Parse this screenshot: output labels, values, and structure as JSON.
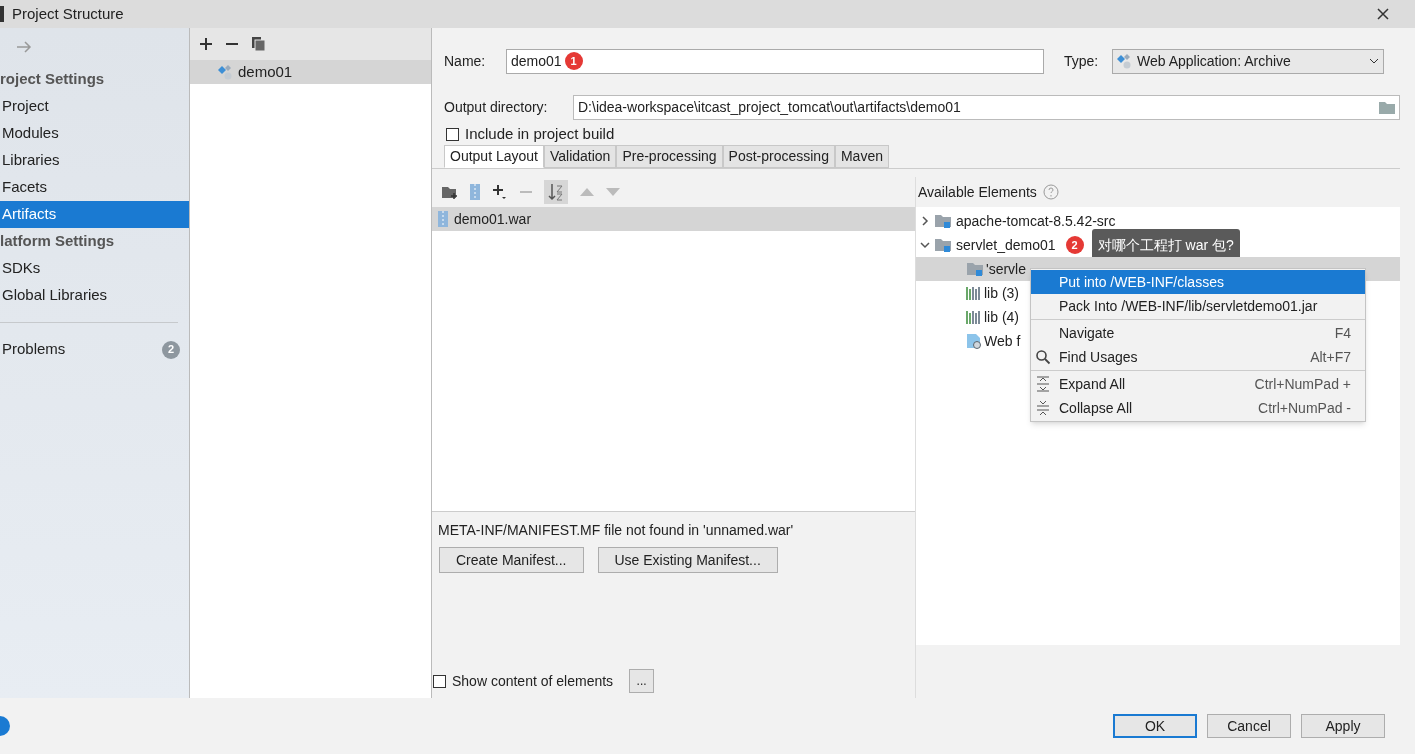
{
  "window": {
    "title": "Project Structure"
  },
  "sidebar": {
    "sections": [
      {
        "header": "roject Settings",
        "items": [
          {
            "label": "Project",
            "selected": false
          },
          {
            "label": "Modules",
            "selected": false
          },
          {
            "label": "Libraries",
            "selected": false
          },
          {
            "label": "Facets",
            "selected": false
          },
          {
            "label": "Artifacts",
            "selected": true
          }
        ]
      },
      {
        "header": "latform Settings",
        "items": [
          {
            "label": "SDKs",
            "selected": false
          },
          {
            "label": "Global Libraries",
            "selected": false
          }
        ]
      }
    ],
    "problems": {
      "label": "Problems",
      "count": "2"
    }
  },
  "artifacts": [
    {
      "label": "demo01",
      "selected": true
    }
  ],
  "form": {
    "name_label": "Name:",
    "name": "demo01",
    "name_marker": "1",
    "type_label": "Type:",
    "type": "Web Application: Archive",
    "output_label": "Output directory:",
    "output": "D:\\idea-workspace\\itcast_project_tomcat\\out\\artifacts\\demo01",
    "include": {
      "label": "Include in project build",
      "checked": false
    }
  },
  "tabs": [
    {
      "label": "Output Layout",
      "selected": true
    },
    {
      "label": "Validation",
      "selected": false
    },
    {
      "label": "Pre-processing",
      "selected": false
    },
    {
      "label": "Post-processing",
      "selected": false
    },
    {
      "label": "Maven",
      "selected": false
    }
  ],
  "output_layout": {
    "items": [
      {
        "label": "demo01.war",
        "selected": true
      }
    ],
    "message": "META-INF/MANIFEST.MF file not found in 'unnamed.war'",
    "buttons": [
      "Create Manifest...",
      "Use Existing Manifest..."
    ]
  },
  "available": {
    "title": "Available Elements",
    "tree": [
      {
        "label": "apache-tomcat-8.5.42-src",
        "expanded": false
      },
      {
        "label": "servlet_demo01",
        "expanded": true,
        "marker": "2",
        "tooltip": "对哪个工程打 war 包?",
        "children": [
          {
            "label": "'servle",
            "kind": "folder",
            "selected": true
          },
          {
            "label": "lib (3)",
            "kind": "library",
            "selected": false
          },
          {
            "label": "lib (4)",
            "kind": "library",
            "selected": false
          },
          {
            "label": "Web f",
            "kind": "web",
            "selected": false
          }
        ]
      }
    ]
  },
  "context_menu": {
    "groups": [
      [
        {
          "label": "Put into /WEB-INF/classes",
          "kind": "plain",
          "selected": true
        },
        {
          "label": "Pack Into /WEB-INF/lib/servletdemo01.jar",
          "kind": "plain",
          "selected": false
        }
      ],
      [
        {
          "label": "Navigate",
          "shortcut": "F4",
          "kind": "plain",
          "selected": false
        },
        {
          "label": "Find Usages",
          "shortcut": "Alt+F7",
          "kind": "search",
          "selected": false
        }
      ],
      [
        {
          "label": "Expand All",
          "shortcut": "Ctrl+NumPad +",
          "kind": "expand",
          "selected": false
        },
        {
          "label": "Collapse All",
          "shortcut": "Ctrl+NumPad -",
          "kind": "collapse",
          "selected": false
        }
      ]
    ]
  },
  "show_content": {
    "label": "Show content of elements",
    "checked": false,
    "more": "..."
  },
  "footer": {
    "buttons": [
      {
        "label": "OK",
        "default": true
      },
      {
        "label": "Cancel",
        "default": false
      },
      {
        "label": "Apply",
        "default": false
      }
    ]
  }
}
